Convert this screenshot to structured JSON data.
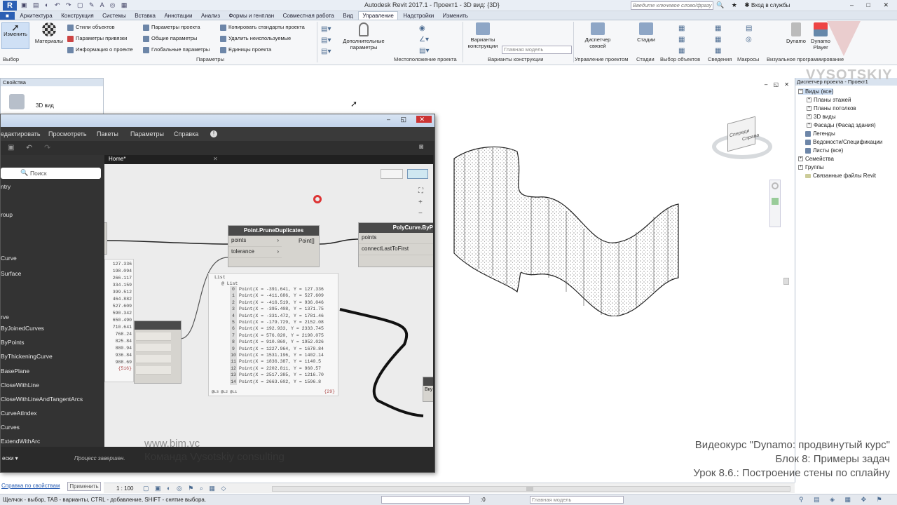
{
  "app": {
    "title": "Autodesk Revit 2017.1 -   Проект1 - 3D вид: {3D}",
    "search_placeholder": "Введите ключевое слово/фразу",
    "login": "Вход в службы"
  },
  "tabs": [
    "R",
    "Архитектура",
    "Конструкция",
    "Системы",
    "Вставка",
    "Аннотации",
    "Анализ",
    "Формы и генплан",
    "Совместная работа",
    "Вид",
    "Управление",
    "Надстройки",
    "Изменить"
  ],
  "ribbon": {
    "modify": "Изменить",
    "materials": "Материалы",
    "col1": [
      "Стили объектов",
      "Параметры привязки",
      "Информация о проекте"
    ],
    "col2": [
      "Параметры проекта",
      "Общие параметры",
      "Глобальные параметры"
    ],
    "col3": [
      "Копировать стандарты проекта",
      "Удалить неиспользуемые",
      "Единицы проекта"
    ],
    "additional": "Дополнительные параметры",
    "variants": "Варианты конструкции",
    "main_model": "Главная модель",
    "dispatcher": "Диспетчер связей",
    "stages": "Стадии",
    "dynamo": "Dynamo",
    "dynamo_player": "Dynamo Player",
    "groups": [
      "Выбор",
      "Параметры",
      "Местоположение проекта",
      "Варианты конструкции",
      "Управление проектом",
      "Стадии",
      "Выбор объектов",
      "Сведения",
      "Макросы",
      "Визуальное программирование"
    ]
  },
  "properties": {
    "title": "Свойства",
    "type": "3D вид",
    "link": "Справка по свойствам",
    "apply": "Применить"
  },
  "browser": {
    "title": "Диспетчер проекта - Проект1",
    "items": [
      "Виды (все)",
      "Планы этажей",
      "Планы потолков",
      "3D виды",
      "Фасады (Фасад здания)",
      "Легенды",
      "Ведомости/Спецификации",
      "Листы (все)",
      "Семейства",
      "Группы",
      "Связанные файлы Revit"
    ]
  },
  "dynamo": {
    "menu": [
      "едактировать",
      "Просмотреть",
      "Пакеты",
      "Параметры",
      "Справка"
    ],
    "tab": "Home*",
    "search": "Поиск",
    "library": [
      "ntry",
      "roup",
      "Curve",
      "Surface",
      "rve",
      "ByJoinedCurves",
      "ByPoints",
      "ByThickeningCurve",
      "BasePlane",
      "CloseWithLine",
      "CloseWithLineAndTangentArcs",
      "CurveAtIndex",
      "Curves",
      "ExtendWithArc"
    ],
    "node1": {
      "title": "Point.PruneDuplicates",
      "in": [
        "points",
        "tolerance"
      ],
      "out": "Point[]"
    },
    "node2": {
      "title": "PolyCurve.ByP",
      "in": [
        "points",
        "connectLastToFirst"
      ]
    },
    "node3_label": "Вку",
    "left_values": [
      "127.336",
      "198.094",
      "266.117",
      "334.159",
      "399.512",
      "464.882",
      "527.609",
      "590.342",
      "650.490",
      "710.641",
      "768.24",
      "825.84",
      "880.94",
      "936.84",
      "988.69"
    ],
    "left_count": "{516}",
    "preview": {
      "header": "List",
      "sub": "@ List",
      "rows": [
        "Point(X = -391.641, Y = 127.336",
        "Point(X = -411.686, Y = 527.609",
        "Point(X = -416.519, Y = 936.046",
        "Point(X = -395.408, Y = 1371.75",
        "Point(X = -331.472, Y = 1781.46",
        "Point(X = -179.729, Y = 2152.08",
        "Point(X = 192.933, Y = 2333.745",
        "Point(X = 576.020, Y = 2190.075",
        "Point(X = 910.860, Y = 1952.026",
        "Point(X = 1227.964, Y = 1678.84",
        "Point(X = 1531.196, Y = 1402.14",
        "Point(X = 1836.387, Y = 1140.5",
        "Point(X = 2202.811, Y = 960.57",
        "Point(X = 2517.385, Y = 1216.70",
        "Point(X = 2663.602, Y = 1596.8"
      ],
      "foot": "@L3 @L2 @L1",
      "count": "{29}"
    },
    "status_mode": "ески",
    "status": "Процесс завершен."
  },
  "statusbar": {
    "hint": "Щелчок - выбор, TAB - варианты, CTRL - добавление, SHIFT - снятие выбора.",
    "scale": "1 : 100",
    "zero": ":0",
    "model": "Главная модель"
  },
  "overlay": {
    "course": "Видеокурс \"Dynamo: продвинутый курс\"",
    "block": "Блок 8: Примеры задач",
    "lesson": "Урок 8.6.: Построение стены по сплайну",
    "site": "www.bim.vc",
    "team": "Команда Vysotskiy consulting",
    "logo": "VYSOTSKIY"
  },
  "viewcube": {
    "face1": "Справа",
    "face2": "Спереди"
  }
}
